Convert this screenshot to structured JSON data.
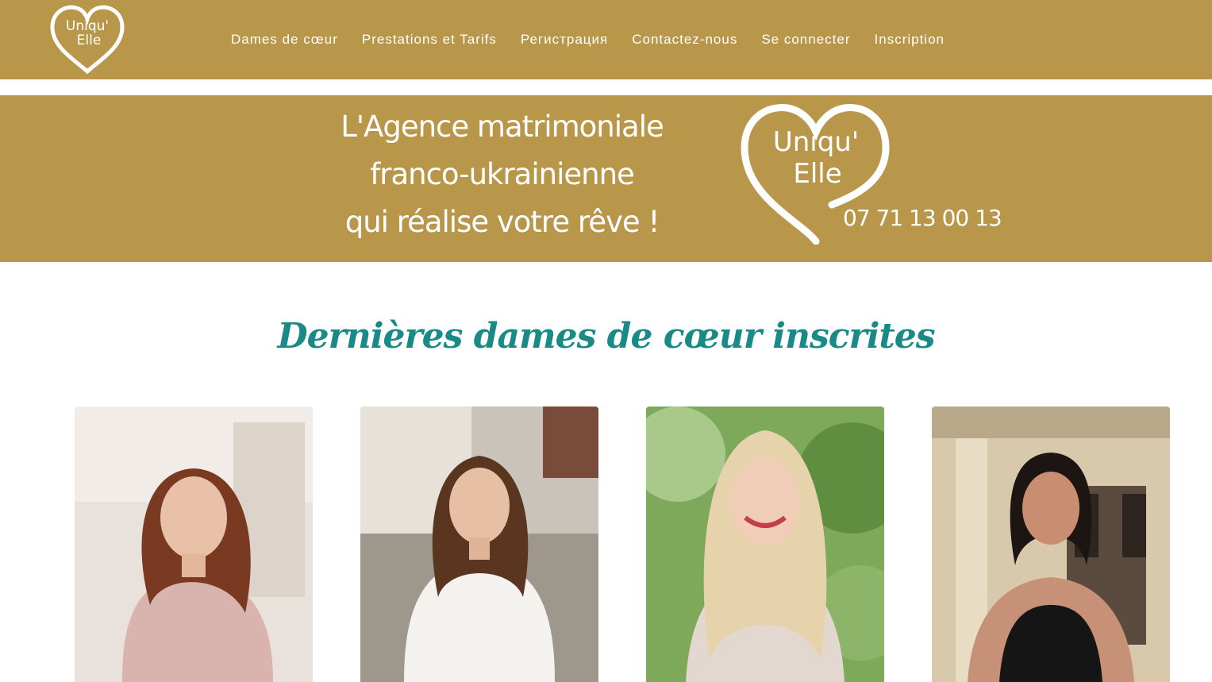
{
  "header": {
    "logo_text_line1": "Uniqu'",
    "logo_text_line2": "Elle",
    "nav": [
      {
        "label": "Dames de cœur"
      },
      {
        "label": "Prestations et Tarifs"
      },
      {
        "label": "Регистрация"
      },
      {
        "label": "Contactez-nous"
      },
      {
        "label": "Se connecter"
      },
      {
        "label": "Inscription"
      }
    ]
  },
  "banner": {
    "line1": "L'Agence matrimoniale",
    "line2": "franco-ukrainienne",
    "line3": "qui réalise votre rêve !",
    "logo_text_line1": "Uniqu'",
    "logo_text_line2": "Elle",
    "phone": "07 71 13 00 13"
  },
  "section": {
    "title": "Dernières dames de cœur inscrites"
  },
  "colors": {
    "brand_gold": "#b8974b",
    "heading_teal": "#1a8a87"
  },
  "profiles": [
    {
      "photo": "woman-pink-dress-photo"
    },
    {
      "photo": "woman-white-top-photo"
    },
    {
      "photo": "woman-blonde-smiling-photo"
    },
    {
      "photo": "woman-black-top-photo"
    }
  ]
}
